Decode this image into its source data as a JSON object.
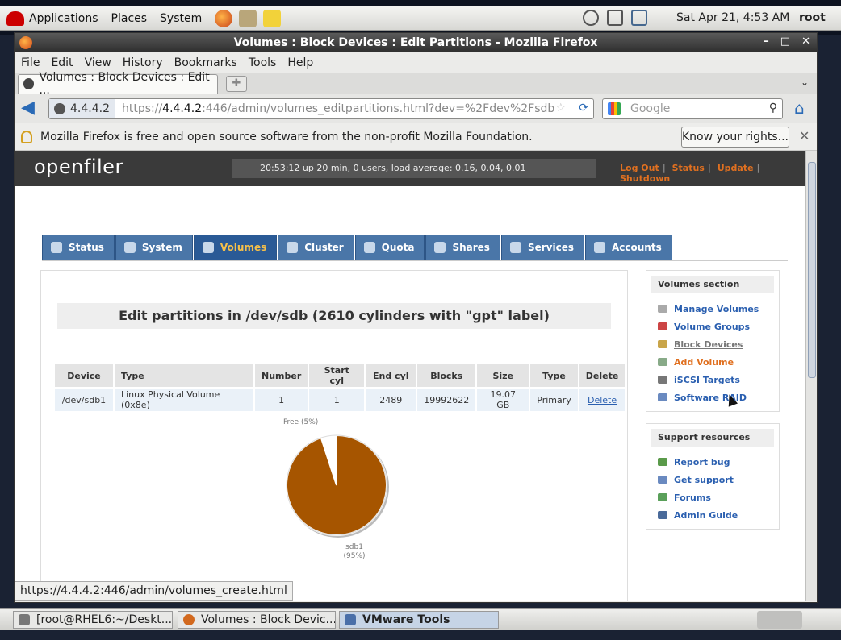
{
  "gnome_panel": {
    "menus": [
      "Applications",
      "Places",
      "System"
    ],
    "clock": "Sat Apr 21,  4:53 AM",
    "user": "root"
  },
  "window": {
    "title": "Volumes : Block Devices : Edit Partitions - Mozilla Firefox",
    "controls": [
      "–",
      "□",
      "✕"
    ]
  },
  "browser": {
    "menubar": [
      "File",
      "Edit",
      "View",
      "History",
      "Bookmarks",
      "Tools",
      "Help"
    ],
    "tab_title": "Volumes : Block Devices : Edit ...",
    "new_tab": "✚",
    "tab_list": "⌄",
    "identity": "4.4.4.2",
    "url_prefix": "https://",
    "url_host": "4.4.4.2",
    "url_rest": ":446/admin/volumes_editpartitions.html?dev=%2Fdev%2Fsdb",
    "search_placeholder": "Google",
    "notification": "Mozilla Firefox is free and open source software from the non-profit Mozilla Foundation.",
    "rights_button": "Know your rights...",
    "close_notification": "✕",
    "status_url": "https://4.4.4.2:446/admin/volumes_create.html"
  },
  "openfiler": {
    "logo": "openfiler",
    "uptime": "20:53:12 up 20 min, 0 users, load average: 0.16, 0.04, 0.01",
    "header_links": [
      "Log Out",
      "Status",
      "Update",
      "Shutdown"
    ],
    "nav_tabs": [
      "Status",
      "System",
      "Volumes",
      "Cluster",
      "Quota",
      "Shares",
      "Services",
      "Accounts"
    ],
    "active_tab": "Volumes",
    "page_title": "Edit partitions in /dev/sdb (2610 cylinders with \"gpt\" label)",
    "table": {
      "headers": [
        "Device",
        "Type",
        "Number",
        "Start cyl",
        "End cyl",
        "Blocks",
        "Size",
        "Type",
        "Delete"
      ],
      "rows": [
        [
          "/dev/sdb1",
          "Linux Physical Volume (0x8e)",
          "1",
          "1",
          "2489",
          "19992622",
          "19.07 GB",
          "Primary",
          "Delete"
        ]
      ]
    },
    "volumes_section": {
      "title": "Volumes section",
      "items": [
        "Manage Volumes",
        "Volume Groups",
        "Block Devices",
        "Add Volume",
        "iSCSI Targets",
        "Software RAID"
      ]
    },
    "support_section": {
      "title": "Support resources",
      "items": [
        "Report bug",
        "Get support",
        "Forums",
        "Admin Guide"
      ]
    }
  },
  "chart_data": {
    "type": "pie",
    "slices": [
      {
        "label": "sdb1",
        "pct_label": "(95%)",
        "value": 95,
        "color": "#a65500"
      },
      {
        "label": "Free",
        "pct_label": "(5%)",
        "value": 5,
        "color": "#ffffff"
      }
    ]
  },
  "taskbar": {
    "items": [
      "[root@RHEL6:~/Deskt...",
      "Volumes : Block Devic...",
      "VMware Tools"
    ]
  },
  "colors": {
    "accent": "#e07020",
    "nav_tab": "#4a76a8",
    "pie_used": "#a65500"
  }
}
